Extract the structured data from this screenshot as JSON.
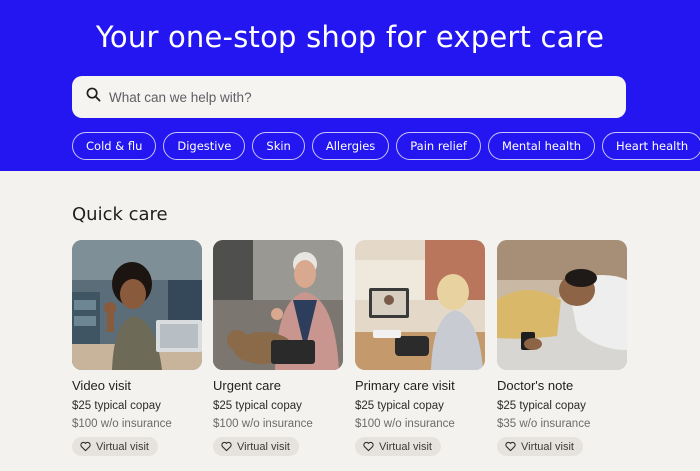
{
  "hero": {
    "title": "Your one-stop shop for expert care",
    "background_color": "#2316f0"
  },
  "search": {
    "icon": "search-icon",
    "placeholder": "What can we help with?",
    "value": ""
  },
  "categories": [
    {
      "label": "Cold & flu"
    },
    {
      "label": "Digestive"
    },
    {
      "label": "Skin"
    },
    {
      "label": "Allergies"
    },
    {
      "label": "Pain relief"
    },
    {
      "label": "Mental health"
    },
    {
      "label": "Heart health"
    }
  ],
  "quick_care": {
    "title": "Quick care",
    "cards": [
      {
        "title": "Video visit",
        "copay": "$25 typical copay",
        "without_insurance": "$100 w/o insurance",
        "badge": "Virtual visit",
        "badge_icon": "heart-icon",
        "image": "woman-on-video-call-photo"
      },
      {
        "title": "Urgent care",
        "copay": "$25 typical copay",
        "without_insurance": "$100 w/o insurance",
        "badge": "Virtual visit",
        "badge_icon": "heart-icon",
        "image": "older-man-with-dog-photo"
      },
      {
        "title": "Primary care visit",
        "copay": "$25 typical copay",
        "without_insurance": "$100 w/o insurance",
        "badge": "Virtual visit",
        "badge_icon": "heart-icon",
        "image": "woman-at-laptop-with-doctor-photo"
      },
      {
        "title": "Doctor's note",
        "copay": "$25 typical copay",
        "without_insurance": "$35 w/o insurance",
        "badge": "Virtual visit",
        "badge_icon": "heart-icon",
        "image": "man-resting-in-bed-photo"
      }
    ]
  }
}
